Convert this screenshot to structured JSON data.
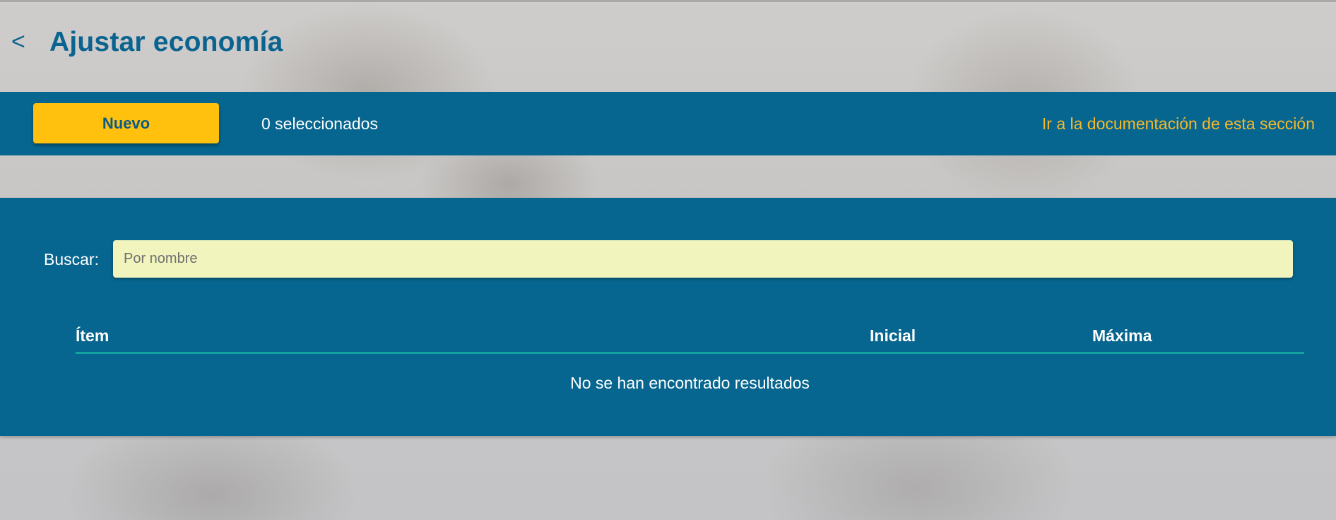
{
  "header": {
    "back_label": "<",
    "title": "Ajustar economía"
  },
  "toolbar": {
    "new_button_label": "Nuevo",
    "selected_count": "0 seleccionados",
    "docs_link": "Ir a la documentación de esta sección"
  },
  "search": {
    "label": "Buscar:",
    "placeholder": "Por nombre",
    "value": ""
  },
  "table": {
    "columns": [
      "Ítem",
      "Inicial",
      "Máxima"
    ],
    "empty_message": "No se han encontrado resultados"
  },
  "colors": {
    "primary": "#07668f",
    "accent": "#ffc10e",
    "link": "#f5b82a",
    "search_bg": "#f1f5bd",
    "divider": "#13a3a0"
  }
}
